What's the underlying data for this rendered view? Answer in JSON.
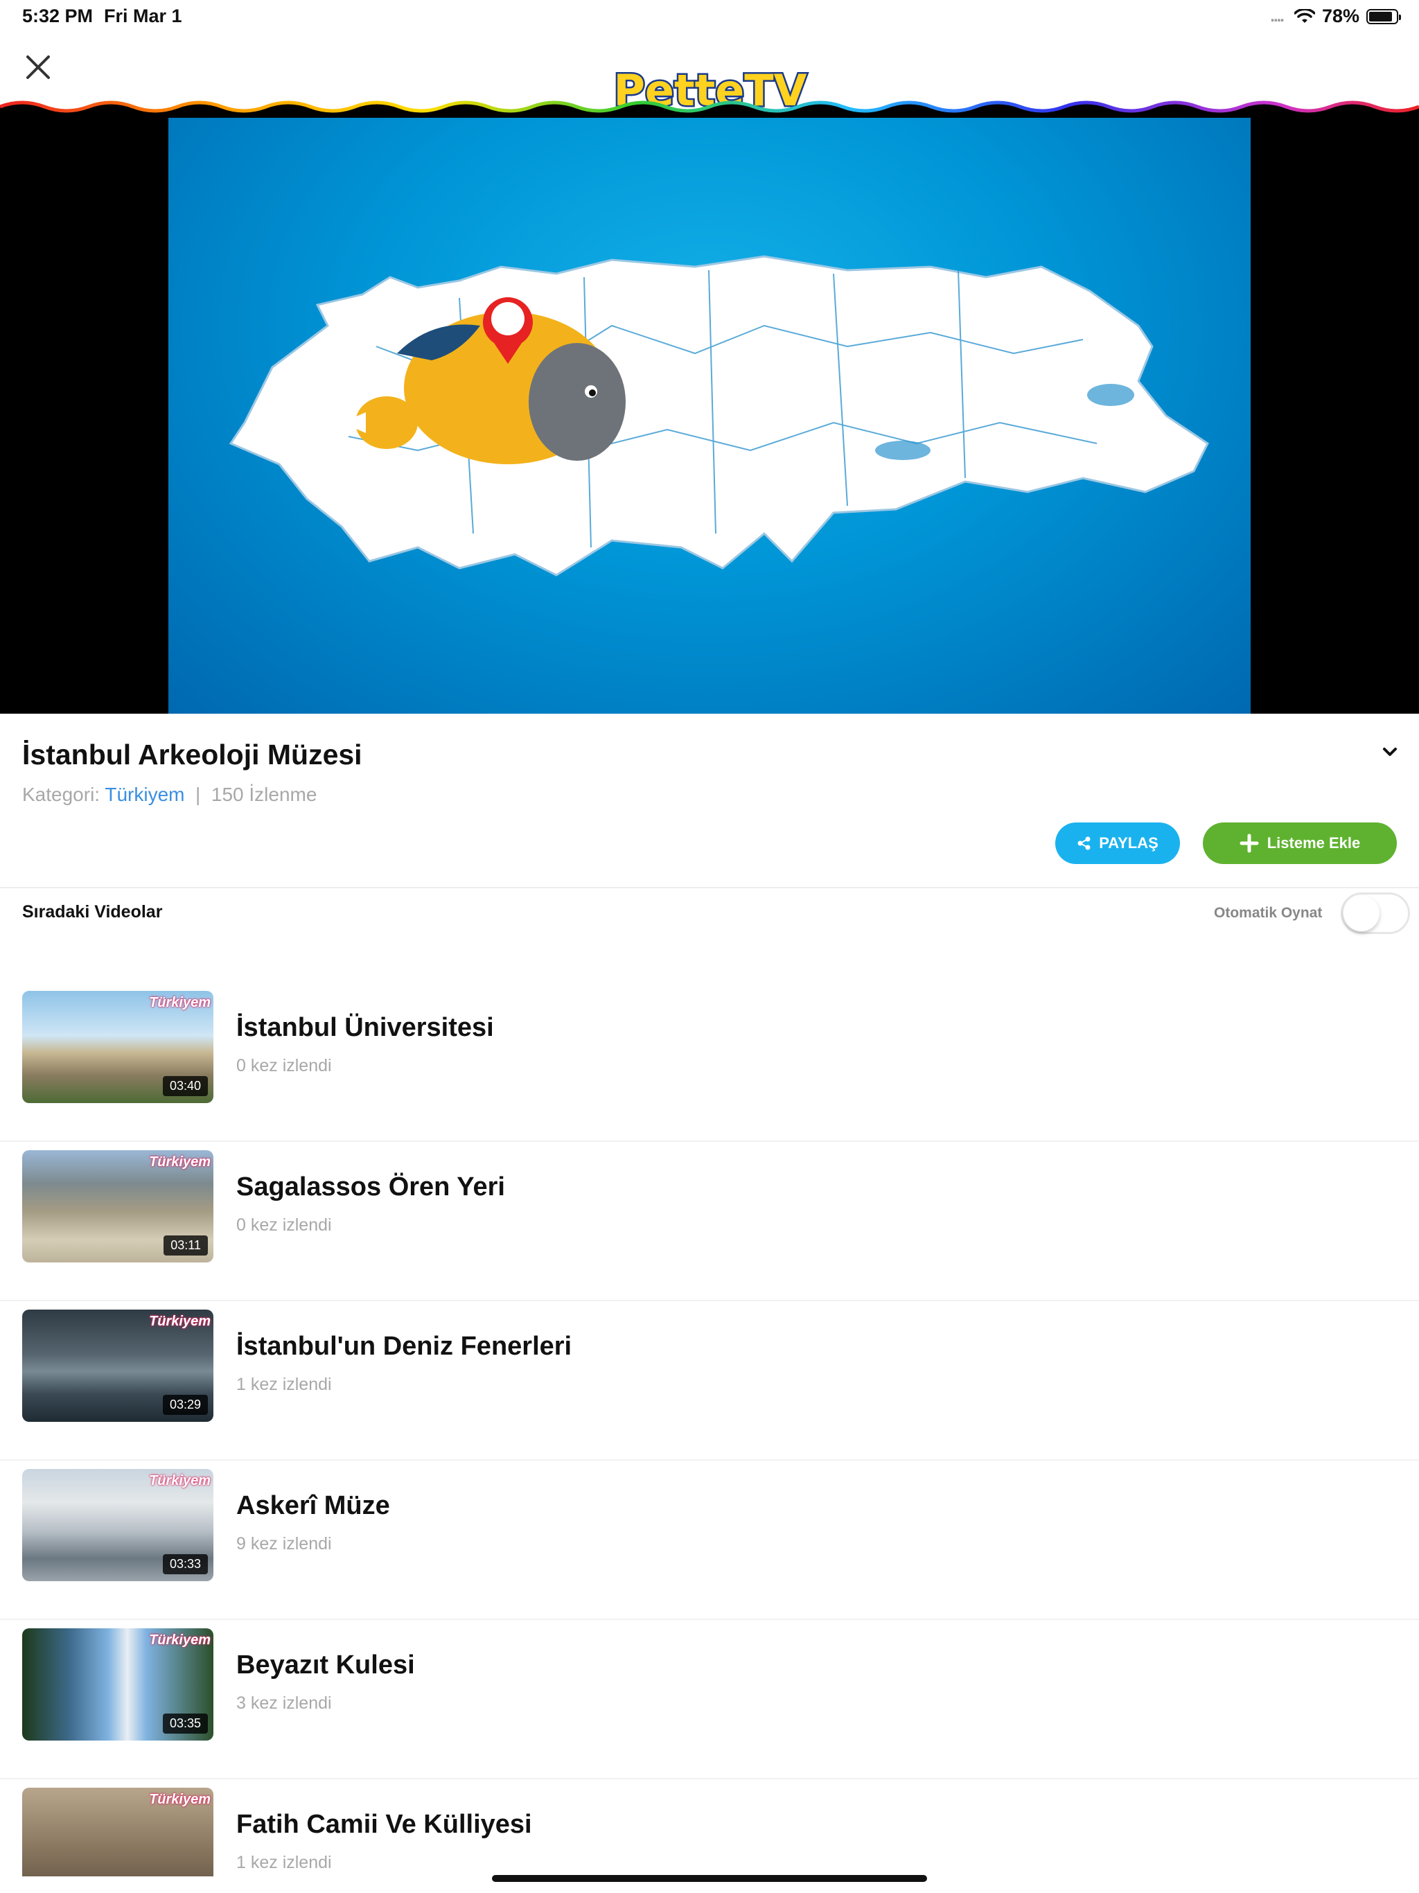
{
  "status_bar": {
    "time": "5:32 PM",
    "date": "Fri Mar 1",
    "signal_dots": "....",
    "battery": "78%",
    "battery_level": 0.78
  },
  "header": {
    "logo_text": "PetteTV"
  },
  "video": {
    "title": "İstanbul Arkeoloji Müzesi",
    "category_label": "Kategori:",
    "category": "Türkiyem",
    "separator": "|",
    "views": "150 İzlenme"
  },
  "actions": {
    "share_label": "PAYLAŞ",
    "add_label": "Listeme Ekle"
  },
  "up_next": {
    "label": "Sıradaki Videolar",
    "autoplay_label": "Otomatik Oynat",
    "autoplay_on": false
  },
  "playlist": [
    {
      "title": "İstanbul Üniversitesi",
      "views": "0 kez izlendi",
      "duration": "03:40",
      "tag": "Türkiyem"
    },
    {
      "title": "Sagalassos Ören Yeri",
      "views": "0 kez izlendi",
      "duration": "03:11",
      "tag": "Türkiyem"
    },
    {
      "title": "İstanbul'un Deniz Fenerleri",
      "views": "1 kez izlendi",
      "duration": "03:29",
      "tag": "Türkiyem"
    },
    {
      "title": "Askerî Müze",
      "views": "9 kez izlendi",
      "duration": "03:33",
      "tag": "Türkiyem"
    },
    {
      "title": "Beyazıt Kulesi",
      "views": "3 kez izlendi",
      "duration": "03:35",
      "tag": "Türkiyem"
    },
    {
      "title": "Fatih Camii Ve Külliyesi",
      "views": "1 kez izlendi",
      "duration": "",
      "tag": "Türkiyem"
    }
  ],
  "colors": {
    "share": "#19b2ef",
    "add": "#5fb22f",
    "category": "#3a8fe0",
    "video_bg": "#0095d6"
  }
}
